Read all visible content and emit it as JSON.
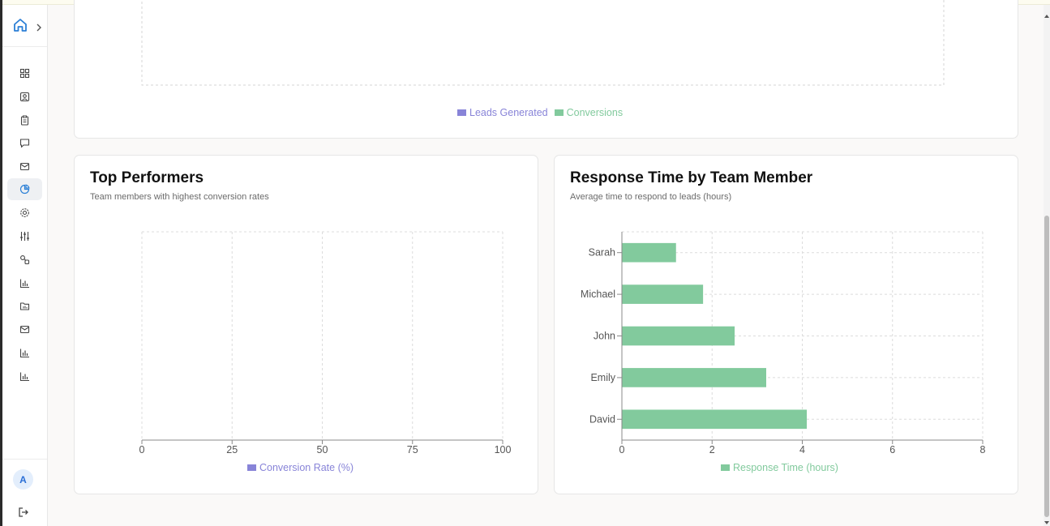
{
  "sidebar": {
    "nav_icons": [
      "dashboard-icon",
      "contacts-icon",
      "clipboard-icon",
      "chat-icon",
      "mail-icon",
      "pie-chart-icon",
      "settings-icon",
      "sliders-icon",
      "integrations-icon",
      "bar-chart-icon",
      "folder-icon",
      "mail-icon",
      "bar-chart-icon",
      "bar-chart-icon"
    ],
    "active_index": 5,
    "avatar_initial": "A"
  },
  "leads_chart": {
    "legend": [
      "Leads Generated",
      "Conversions"
    ]
  },
  "top_performers": {
    "title": "Top Performers",
    "subtitle": "Team members with highest conversion rates"
  },
  "response_time": {
    "title": "Response Time by Team Member",
    "subtitle": "Average time to respond to leads (hours)"
  },
  "colors": {
    "leads": "#8884d8",
    "conversions": "#82ca9d",
    "active_nav": "#2b7fd6"
  },
  "chart_data": [
    {
      "type": "bar",
      "orientation": "horizontal",
      "title": "Top Performers",
      "categories": [],
      "series": [
        {
          "name": "Conversion Rate (%)",
          "values": []
        }
      ],
      "x_ticks": [
        0,
        25,
        50,
        75,
        100
      ],
      "xlim": [
        0,
        100
      ],
      "grid": true,
      "legend": "bottom"
    },
    {
      "type": "bar",
      "orientation": "horizontal",
      "title": "Response Time by Team Member",
      "categories": [
        "Sarah",
        "Michael",
        "John",
        "Emily",
        "David"
      ],
      "series": [
        {
          "name": "Response Time (hours)",
          "values": [
            1.2,
            1.8,
            2.5,
            3.2,
            4.1
          ]
        }
      ],
      "x_ticks": [
        0,
        2,
        4,
        6,
        8
      ],
      "xlim": [
        0,
        8
      ],
      "grid": true,
      "legend": "bottom"
    }
  ]
}
